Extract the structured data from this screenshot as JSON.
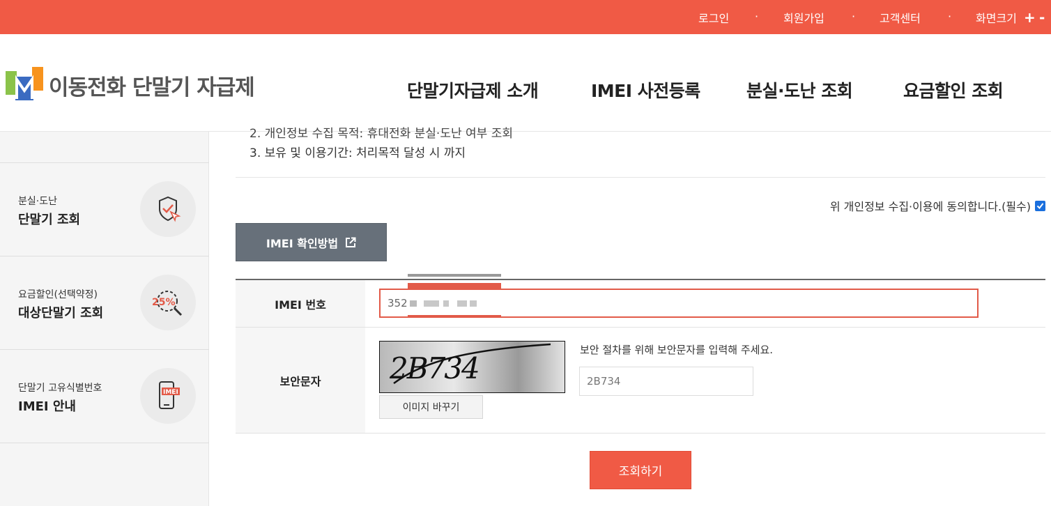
{
  "util_nav": {
    "login": "로그인",
    "signup": "회원가입",
    "support": "고객센터",
    "font_size": "화면크기",
    "font_plus": "+",
    "font_minus": "-",
    "separator": "·"
  },
  "logo": {
    "text": "이동전화 단말기 자급제"
  },
  "gnb": {
    "items": [
      "단말기자급제 소개",
      "IMEI 사전등록",
      "분실·도난 조회",
      "요금할인 조회"
    ]
  },
  "sidebar": {
    "items": [
      {
        "sub": "분실·도난",
        "main": "단말기 조회",
        "icon": "shield-check-icon"
      },
      {
        "sub": "요금할인(선택약정)",
        "main": "대상단말기 조회",
        "icon": "percent-search-icon",
        "icon_text": "25%"
      },
      {
        "sub": "단말기 고유식별번호",
        "main": "IMEI 안내",
        "icon": "phone-imei-icon",
        "icon_text": "IMEI"
      }
    ]
  },
  "notice": {
    "line2_clipped": "2. 개인정보 수집 목적: 휴대전화 분실·도난 여부 조회",
    "line3": "3. 보유 및 이용기간: 처리목적 달성 시 까지"
  },
  "agree": {
    "label": "위 개인정보 수집·이용에 동의합니다.(필수)",
    "checked": true
  },
  "imei_guide_button": {
    "label": "IMEI 확인방법"
  },
  "form": {
    "imei_label": "IMEI 번호",
    "imei_value": "352",
    "captcha_label": "보안문자",
    "captcha_code": "2B734",
    "captcha_desc": "보안 절차를 위해 보안문자를 입력해 주세요.",
    "captcha_input_value": "2B734",
    "reload_button": "이미지 바꾸기"
  },
  "search_button": {
    "label": "조회하기"
  },
  "colors": {
    "accent": "#f05a45",
    "button_gray": "#67707a",
    "checkbox": "#1a6fdd"
  }
}
